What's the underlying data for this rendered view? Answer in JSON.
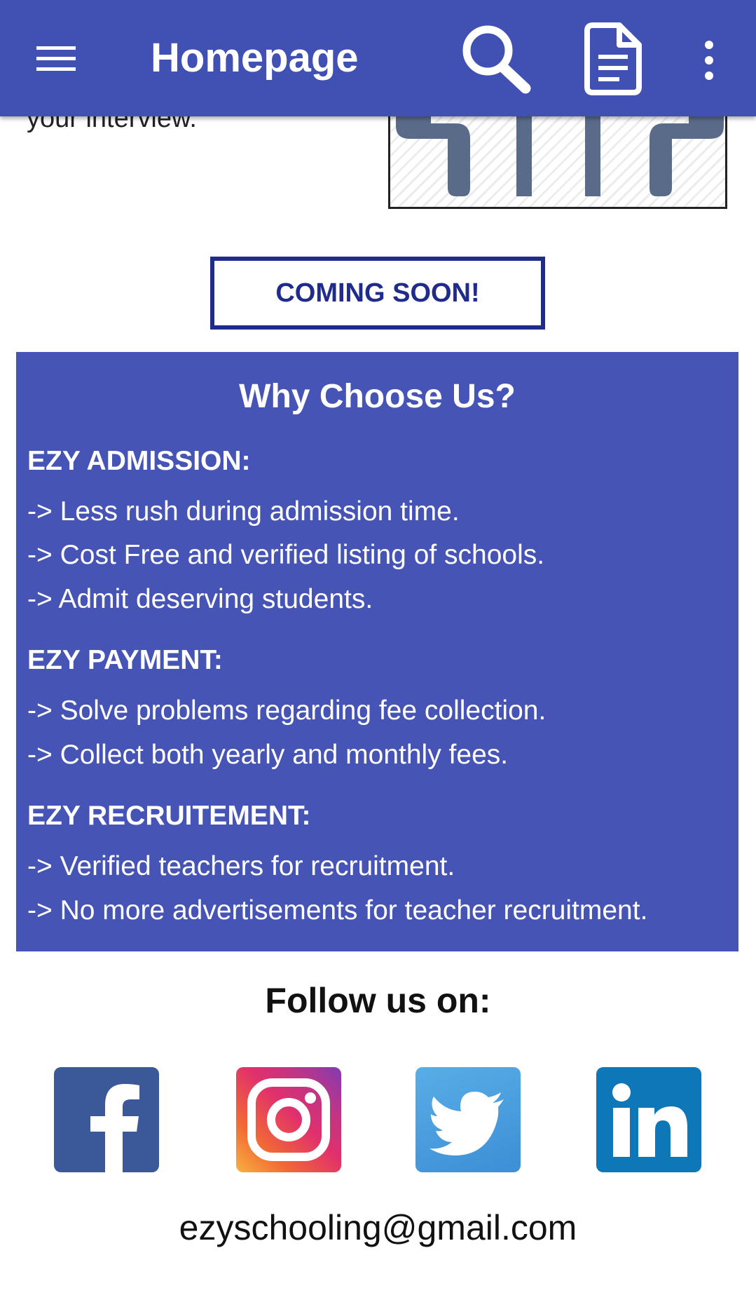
{
  "app_bar": {
    "title": "Homepage",
    "icons": [
      "menu-icon",
      "search-icon",
      "document-icon",
      "more-vert-icon"
    ],
    "background": "#4151b3"
  },
  "interview": {
    "text_fragment": "your interview."
  },
  "coming_soon": {
    "label": "COMING SOON!",
    "color": "#1f2c8c"
  },
  "why_choose": {
    "title": "Why Choose Us?",
    "background": "#4554b5",
    "sections": [
      {
        "heading": "EZY ADMISSION:",
        "points": [
          "-> Less rush during admission time.",
          "-> Cost Free and verified listing of schools.",
          "-> Admit deserving students."
        ]
      },
      {
        "heading": "EZY PAYMENT:",
        "points": [
          "-> Solve problems regarding fee collection.",
          "-> Collect both yearly and monthly fees."
        ]
      },
      {
        "heading": "EZY RECRUITEMENT:",
        "points": [
          "-> Verified teachers for recruitment.",
          "-> No more advertisements for teacher recruitment."
        ]
      }
    ]
  },
  "follow": {
    "title": "Follow us on:",
    "icons": [
      "facebook-icon",
      "instagram-icon",
      "twitter-icon",
      "linkedin-icon"
    ]
  },
  "contact": {
    "email": "ezyschooling@gmail.com"
  }
}
